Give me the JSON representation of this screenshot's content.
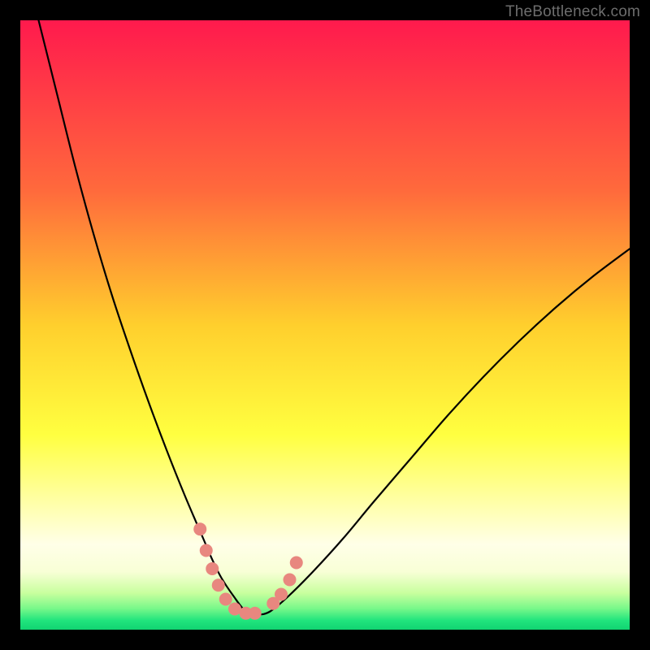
{
  "watermark": "TheBottleneck.com",
  "chart_data": {
    "type": "line",
    "title": "",
    "xlabel": "",
    "ylabel": "",
    "xlim": [
      0,
      100
    ],
    "ylim": [
      0,
      100
    ],
    "gradient_stops": [
      {
        "offset": 0,
        "color": "#ff1a4d"
      },
      {
        "offset": 0.28,
        "color": "#ff6a3c"
      },
      {
        "offset": 0.5,
        "color": "#ffcf2d"
      },
      {
        "offset": 0.68,
        "color": "#ffff40"
      },
      {
        "offset": 0.8,
        "color": "#ffffb0"
      },
      {
        "offset": 0.86,
        "color": "#ffffe8"
      },
      {
        "offset": 0.905,
        "color": "#f8ffd6"
      },
      {
        "offset": 0.94,
        "color": "#c8ff9e"
      },
      {
        "offset": 0.965,
        "color": "#79f88a"
      },
      {
        "offset": 0.985,
        "color": "#20e47d"
      },
      {
        "offset": 1.0,
        "color": "#11d472"
      }
    ],
    "series": [
      {
        "name": "bottleneck-curve",
        "x": [
          3,
          6,
          9,
          12,
          15,
          18,
          21,
          24,
          27,
          30,
          31.5,
          33,
          35,
          37,
          39,
          41,
          44,
          48,
          53,
          58,
          64,
          70,
          76,
          82,
          88,
          94,
          100
        ],
        "y": [
          100,
          88,
          76,
          65,
          55,
          46,
          37.5,
          29.5,
          22,
          15,
          11.5,
          8.5,
          5.5,
          3,
          2.5,
          3,
          5.5,
          9.5,
          15,
          21,
          28,
          35,
          41.5,
          47.5,
          53,
          58,
          62.5
        ]
      }
    ],
    "markers": {
      "name": "highlight-dots",
      "color": "#e8877f",
      "radius_px": 8,
      "points": [
        {
          "x": 29.5,
          "y": 16.5
        },
        {
          "x": 30.5,
          "y": 13.0
        },
        {
          "x": 31.5,
          "y": 10.0
        },
        {
          "x": 32.5,
          "y": 7.3
        },
        {
          "x": 33.7,
          "y": 5.0
        },
        {
          "x": 35.2,
          "y": 3.4
        },
        {
          "x": 37.0,
          "y": 2.7
        },
        {
          "x": 38.5,
          "y": 2.7
        },
        {
          "x": 41.5,
          "y": 4.3
        },
        {
          "x": 42.8,
          "y": 5.8
        },
        {
          "x": 44.2,
          "y": 8.2
        },
        {
          "x": 45.3,
          "y": 11.0
        }
      ]
    }
  }
}
